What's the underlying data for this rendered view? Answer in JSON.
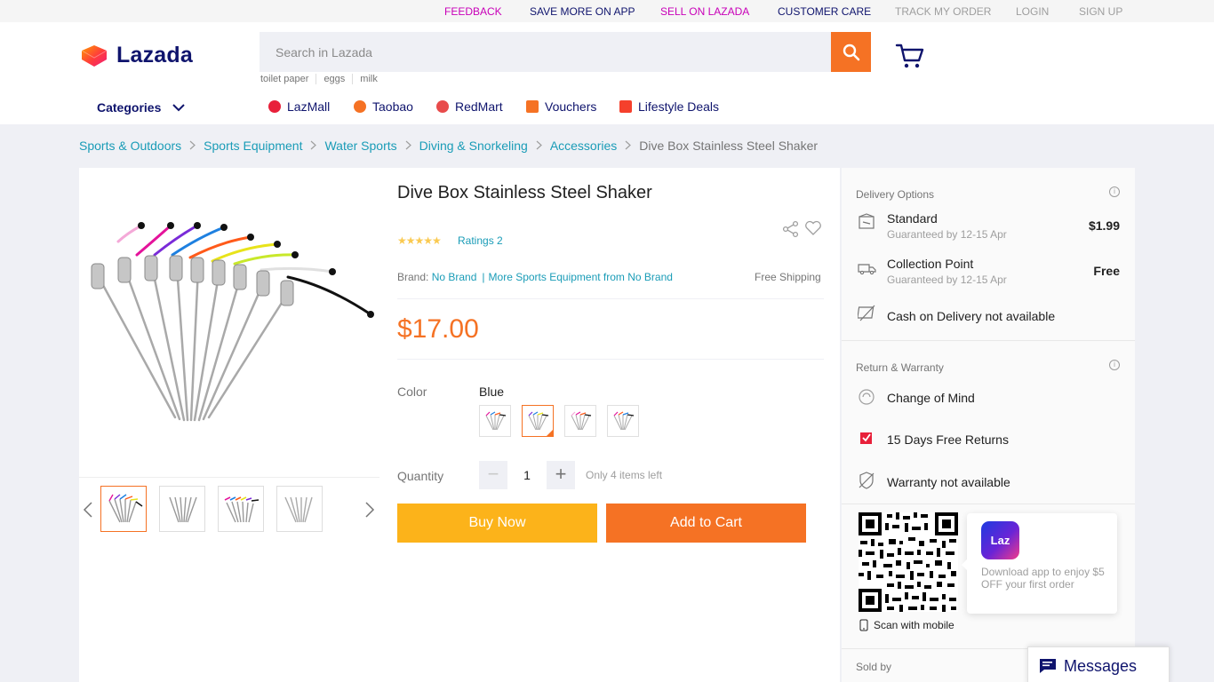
{
  "topbar": {
    "links": [
      {
        "label": "FEEDBACK",
        "color": "#c800b8"
      },
      {
        "label": "SAVE MORE ON APP",
        "color": "#0f146d"
      },
      {
        "label": "SELL ON LAZADA",
        "color": "#c800b8"
      },
      {
        "label": "CUSTOMER CARE",
        "color": "#0f146d"
      },
      {
        "label": "TRACK MY ORDER",
        "color": "#9e9e9e"
      },
      {
        "label": "LOGIN",
        "color": "#9e9e9e"
      },
      {
        "label": "SIGN UP",
        "color": "#9e9e9e"
      }
    ]
  },
  "header": {
    "logo_text": "Lazada",
    "search_placeholder": "Search in Lazada",
    "suggestions": [
      "toilet paper",
      "eggs",
      "milk"
    ],
    "categories_label": "Categories",
    "nav": [
      {
        "label": "LazMall",
        "icon": "lazmall-icon",
        "color": "#e8203a"
      },
      {
        "label": "Taobao",
        "icon": "taobao-icon",
        "color": "#f57224"
      },
      {
        "label": "RedMart",
        "icon": "redmart-icon",
        "color": "#e84b4b"
      },
      {
        "label": "Vouchers",
        "icon": "voucher-icon",
        "color": "#f57224"
      },
      {
        "label": "Lifestyle Deals",
        "icon": "lifestyle-icon",
        "color": "#f5402c"
      }
    ]
  },
  "breadcrumb": {
    "items": [
      "Sports & Outdoors",
      "Sports Equipment",
      "Water Sports",
      "Diving & Snorkeling",
      "Accessories"
    ],
    "current": "Dive Box Stainless Steel Shaker"
  },
  "product": {
    "title": "Dive Box Stainless Steel Shaker",
    "stars": "★★★★★",
    "ratings": "Ratings 2",
    "brand_label": "Brand:",
    "brand": "No Brand",
    "more_link": "More Sports Equipment from No Brand",
    "free_shipping": "Free Shipping",
    "price": "$17.00",
    "color_label": "Color",
    "color_value": "Blue",
    "quantity_label": "Quantity",
    "quantity_value": "1",
    "minus": "−",
    "plus": "+",
    "stock_note": "Only 4 items left",
    "buy_now": "Buy Now",
    "add_to_cart": "Add to Cart"
  },
  "delivery": {
    "header": "Delivery Options",
    "info": "i",
    "options": [
      {
        "title": "Standard",
        "sub": "Guaranteed by 12-15 Apr",
        "price": "$1.99"
      },
      {
        "title": "Collection Point",
        "sub": "Guaranteed by 12-15 Apr",
        "price": "Free"
      },
      {
        "title": "Cash on Delivery not available"
      }
    ]
  },
  "warranty": {
    "header": "Return & Warranty",
    "info": "i",
    "items": [
      "Change of Mind",
      "15 Days Free Returns",
      "Warranty not available"
    ]
  },
  "app_promo": {
    "app_icon_text": "Laz",
    "text": "Download app to enjoy $5 OFF your first order",
    "scan": "Scan with mobile"
  },
  "seller": {
    "label": "Sold by"
  },
  "messages": {
    "label": "Messages"
  },
  "colors": {
    "brand": "#f57224",
    "link": "#1a9cb7",
    "navy": "#0f146d",
    "buy": "#fcb31a"
  }
}
